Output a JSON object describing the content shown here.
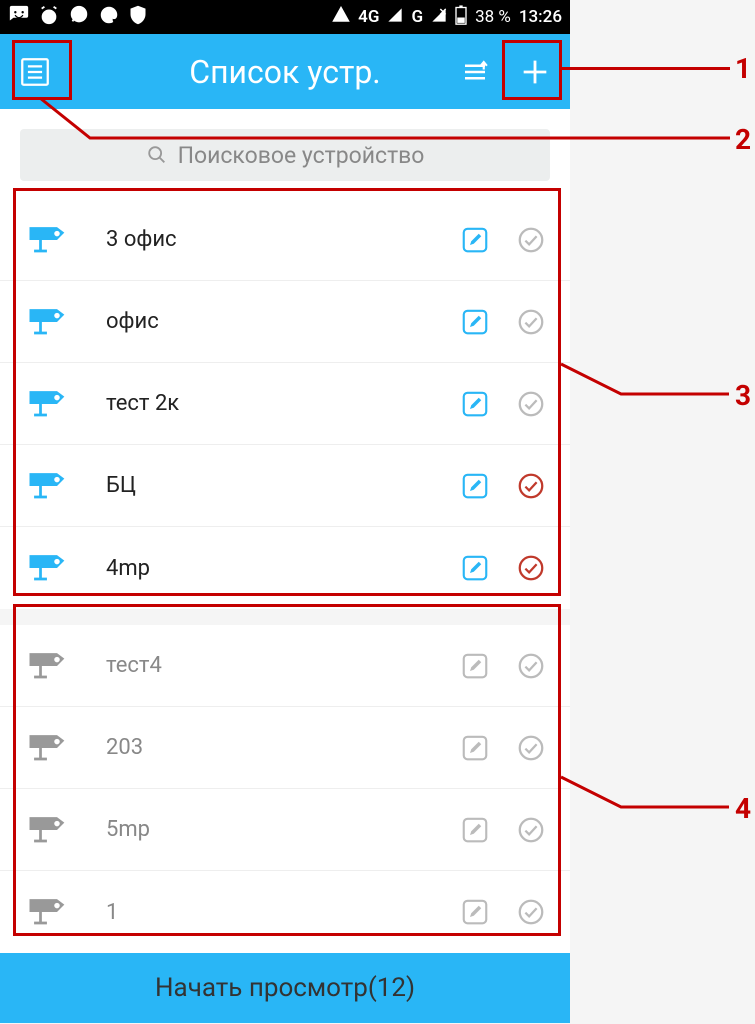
{
  "statusbar": {
    "network1": "4G",
    "network2": "G",
    "battery": "38 %",
    "time": "13:26"
  },
  "titlebar": {
    "title": "Список устр."
  },
  "search": {
    "placeholder": "Поисковое устройство"
  },
  "groups": [
    {
      "online": true,
      "items": [
        {
          "name": "3 офис",
          "checked": false
        },
        {
          "name": "офис",
          "checked": false
        },
        {
          "name": "тест 2к",
          "checked": false
        },
        {
          "name": "БЦ",
          "checked": true
        },
        {
          "name": "4mp",
          "checked": true
        }
      ]
    },
    {
      "online": false,
      "items": [
        {
          "name": "тест4",
          "checked": false
        },
        {
          "name": "203",
          "checked": false
        },
        {
          "name": "5mp",
          "checked": false
        },
        {
          "name": "1",
          "checked": false
        }
      ]
    }
  ],
  "bottom": {
    "label": "Начать просмотр(12)"
  },
  "annotations": {
    "n1": "1",
    "n2": "2",
    "n3": "3",
    "n4": "4"
  }
}
